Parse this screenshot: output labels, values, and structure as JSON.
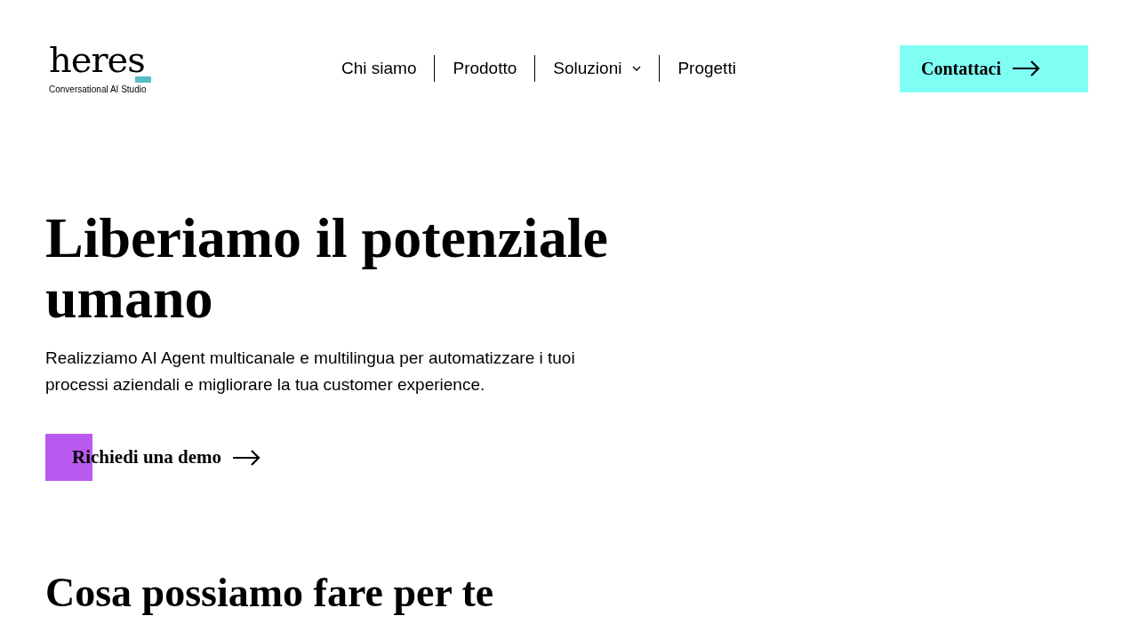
{
  "logo": {
    "wordmark": "heres",
    "tagline": "Conversational AI Studio"
  },
  "nav": [
    {
      "label": "Chi siamo",
      "kind": "link"
    },
    {
      "label": "Prodotto",
      "kind": "link"
    },
    {
      "label": "Soluzioni",
      "kind": "dropdown"
    },
    {
      "label": "Progetti",
      "kind": "link"
    }
  ],
  "contact_button": "Contattaci",
  "hero": {
    "title": "Liberiamo il potenziale umano",
    "subtitle": "Realizziamo AI Agent multicanale e multilingua per automatizzare i tuoi processi aziendali e migliorare la tua customer experience.",
    "button": "Richiedi una demo"
  },
  "section_title": "Cosa possiamo fare per te"
}
